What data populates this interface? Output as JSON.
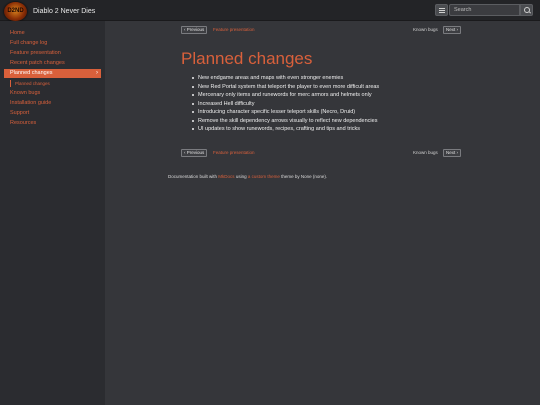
{
  "header": {
    "brand": "Diablo 2 Never Dies",
    "logo_text": "D2ND",
    "toc_icon": "list-icon",
    "search_placeholder": "Search",
    "search_icon": "search-icon"
  },
  "sidebar": {
    "items": [
      {
        "label": "Home"
      },
      {
        "label": "Full change log"
      },
      {
        "label": "Feature presentation"
      },
      {
        "label": "Recent patch changes"
      },
      {
        "label": "Planned changes",
        "active": true
      },
      {
        "label": "Known bugs"
      },
      {
        "label": "Installation guide"
      },
      {
        "label": "Support"
      },
      {
        "label": "Resources"
      }
    ],
    "sub_item": "Planned changes",
    "active_chevron": "›"
  },
  "pager": {
    "previous_label": "‹ Previous",
    "previous_title": "Feature presentation",
    "next_title": "Known bugs",
    "next_label": "Next ›"
  },
  "main": {
    "title": "Planned changes",
    "bullets": [
      "New endgame areas and maps with even stronger enemies",
      "New Red Portal system that teleport the player to even more difficult areas",
      "Mercenary only items and runewords for merc armors and helmets only",
      "Increased Hell difficulty",
      "Introducing character specific lesser teleport skills (Necro, Druid)",
      "Remove the skill dependency arrows visually to reflect new dependencies",
      "UI updates to show runewords, recipes, crafting and tips and tricks"
    ]
  },
  "footer": {
    "prefix": "Documentation built with",
    "mkdocs": "MkDocs",
    "using": "using",
    "theme_link": "a custom theme",
    "suffix": "theme by None (none)."
  },
  "colors": {
    "accent": "#d9603b",
    "background": "#35363a",
    "sidebar": "#2b2c30",
    "navbar": "#232427"
  }
}
